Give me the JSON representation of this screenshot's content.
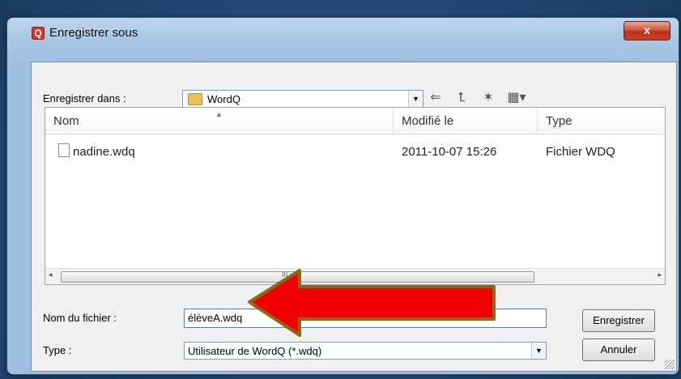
{
  "window": {
    "title": "Enregistrer sous",
    "close_glyph": "x"
  },
  "top": {
    "save_in_label": "Enregistrer dans :",
    "folder_value": "WordQ"
  },
  "columns": [
    "Nom",
    "Modifié le",
    "Type"
  ],
  "files": [
    {
      "name": "nadine.wdq",
      "modified": "2011-10-07 15:26",
      "type": "Fichier WDQ"
    }
  ],
  "scroll_mark": "III",
  "form": {
    "filename_label": "Nom du fichier :",
    "filename_value": "élèveA.wdq",
    "type_label": "Type :",
    "type_value": "Utilisateur de WordQ (*.wdq)"
  },
  "buttons": {
    "save": "Enregistrer",
    "cancel": "Annuler"
  },
  "colors": {
    "arrow_fill": "#ee0000",
    "arrow_stroke": "#8a6a1a",
    "close_button": "#c7442d"
  },
  "icons": [
    "app-icon",
    "close-icon",
    "folder-icon",
    "back-arrow-icon",
    "up-folder-icon",
    "new-folder-icon",
    "view-menu-icon",
    "file-icon",
    "sort-up-icon",
    "scroll-left-icon",
    "scroll-right-icon",
    "dropdown-arrow-icon"
  ]
}
